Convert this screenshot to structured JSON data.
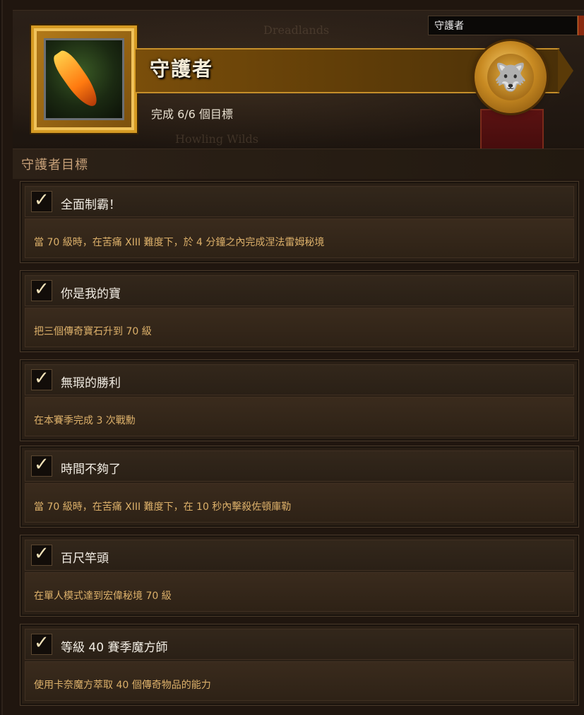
{
  "search": {
    "value": "守護者"
  },
  "achievement": {
    "title": "守護者",
    "progress": "完成 6/6 個目標"
  },
  "map_labels": [
    "Dreadlands",
    "Howling Wilds"
  ],
  "section": {
    "title": "守護者目標"
  },
  "objectives": [
    {
      "title": "全面制霸！",
      "description": "當 70 級時，在苦痛 XIII 難度下，於 4 分鐘之內完成涅法雷姆秘境",
      "completed": true
    },
    {
      "title": "你是我的寶",
      "description": "把三個傳奇寶石升到 70 級",
      "completed": true
    },
    {
      "title": "無瑕的勝利",
      "description": "在本賽季完成 3 次戰勳",
      "completed": true
    },
    {
      "title": "時間不夠了",
      "description": "當 70 級時，在苦痛 XIII 難度下，在 10 秒內擊殺佐頓庫勒",
      "completed": true
    },
    {
      "title": "百尺竿頭",
      "description": "在單人模式達到宏偉秘境 70 級",
      "completed": true
    },
    {
      "title": "等級 40 賽季魔方師",
      "description": "使用卡奈魔方萃取 40 個傳奇物品的能力",
      "completed": true
    }
  ],
  "icons": {
    "check": "✓",
    "emblem": "🐺"
  },
  "colors": {
    "gold": "#d59a23",
    "desc_text": "#dcb06a",
    "banner_red": "#5a1212"
  }
}
